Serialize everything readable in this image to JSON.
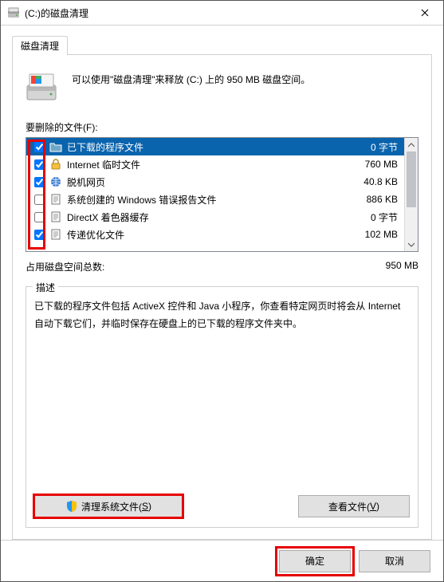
{
  "window": {
    "title": "(C:)的磁盘清理"
  },
  "tab": {
    "label": "磁盘清理"
  },
  "info": {
    "text": "可以使用\"磁盘清理\"来释放  (C:) 上的 950 MB 磁盘空间。"
  },
  "files": {
    "label": "要删除的文件(F):",
    "items": [
      {
        "checked": true,
        "icon": "folder",
        "name": "已下载的程序文件",
        "size": "0 字节",
        "selected": true
      },
      {
        "checked": true,
        "icon": "lock",
        "name": "Internet 临时文件",
        "size": "760 MB"
      },
      {
        "checked": true,
        "icon": "web",
        "name": "脱机网页",
        "size": "40.8 KB"
      },
      {
        "checked": false,
        "icon": "file",
        "name": "系统创建的 Windows 错误报告文件",
        "size": "886 KB"
      },
      {
        "checked": false,
        "icon": "file",
        "name": "DirectX 着色器缓存",
        "size": "0 字节"
      },
      {
        "checked": true,
        "icon": "file",
        "name": "传递优化文件",
        "size": "102 MB"
      }
    ]
  },
  "total": {
    "label": "占用磁盘空间总数:",
    "value": "950 MB"
  },
  "description": {
    "title": "描述",
    "text": "已下载的程序文件包括 ActiveX 控件和 Java 小程序，你查看特定网页时将会从 Internet 自动下载它们，并临时保存在硬盘上的已下载的程序文件夹中。"
  },
  "buttons": {
    "clean_system": "清理系统文件(",
    "clean_system_key": "S",
    "clean_system_suffix": ")",
    "view_files": "查看文件(",
    "view_files_key": "V",
    "view_files_suffix": ")",
    "ok": "确定",
    "cancel": "取消"
  }
}
